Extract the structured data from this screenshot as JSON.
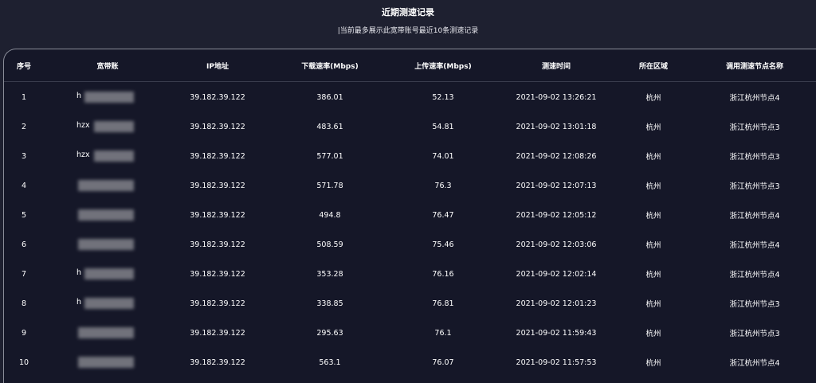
{
  "title": "近期测速记录",
  "subtitle": "|当前最多展示此宽带账号最近10条测速记录",
  "headers": [
    "序号",
    "宽带账",
    "IP地址",
    "下载速率(Mbps)",
    "上传速率(Mbps)",
    "测速时间",
    "所在区域",
    "调用测速节点名称"
  ],
  "rows": [
    {
      "idx": "1",
      "account": "h",
      "ip": "39.182.39.122",
      "down": "386.01",
      "up": "52.13",
      "time": "2021-09-02 13:26:21",
      "region": "杭州",
      "node": "浙江杭州节点4"
    },
    {
      "idx": "2",
      "account": "hzx",
      "ip": "39.182.39.122",
      "down": "483.61",
      "up": "54.81",
      "time": "2021-09-02 13:01:18",
      "region": "杭州",
      "node": "浙江杭州节点3"
    },
    {
      "idx": "3",
      "account": "hzx",
      "ip": "39.182.39.122",
      "down": "577.01",
      "up": "74.01",
      "time": "2021-09-02 12:08:26",
      "region": "杭州",
      "node": "浙江杭州节点3"
    },
    {
      "idx": "4",
      "account": "",
      "ip": "39.182.39.122",
      "down": "571.78",
      "up": "76.3",
      "time": "2021-09-02 12:07:13",
      "region": "杭州",
      "node": "浙江杭州节点3"
    },
    {
      "idx": "5",
      "account": "",
      "ip": "39.182.39.122",
      "down": "494.8",
      "up": "76.47",
      "time": "2021-09-02 12:05:12",
      "region": "杭州",
      "node": "浙江杭州节点4"
    },
    {
      "idx": "6",
      "account": "",
      "ip": "39.182.39.122",
      "down": "508.59",
      "up": "75.46",
      "time": "2021-09-02 12:03:06",
      "region": "杭州",
      "node": "浙江杭州节点4"
    },
    {
      "idx": "7",
      "account": "h",
      "ip": "39.182.39.122",
      "down": "353.28",
      "up": "76.16",
      "time": "2021-09-02 12:02:14",
      "region": "杭州",
      "node": "浙江杭州节点4"
    },
    {
      "idx": "8",
      "account": "h",
      "ip": "39.182.39.122",
      "down": "338.85",
      "up": "76.81",
      "time": "2021-09-02 12:01:23",
      "region": "杭州",
      "node": "浙江杭州节点3"
    },
    {
      "idx": "9",
      "account": "",
      "ip": "39.182.39.122",
      "down": "295.63",
      "up": "76.1",
      "time": "2021-09-02 11:59:43",
      "region": "杭州",
      "node": "浙江杭州节点3"
    },
    {
      "idx": "10",
      "account": "",
      "ip": "39.182.39.122",
      "down": "563.1",
      "up": "76.07",
      "time": "2021-09-02 11:57:53",
      "region": "杭州",
      "node": "浙江杭州节点4"
    }
  ],
  "colors": {
    "background": "#1e2030",
    "panel": "#151728",
    "text": "#ffffff",
    "border": "#8a8d99"
  }
}
